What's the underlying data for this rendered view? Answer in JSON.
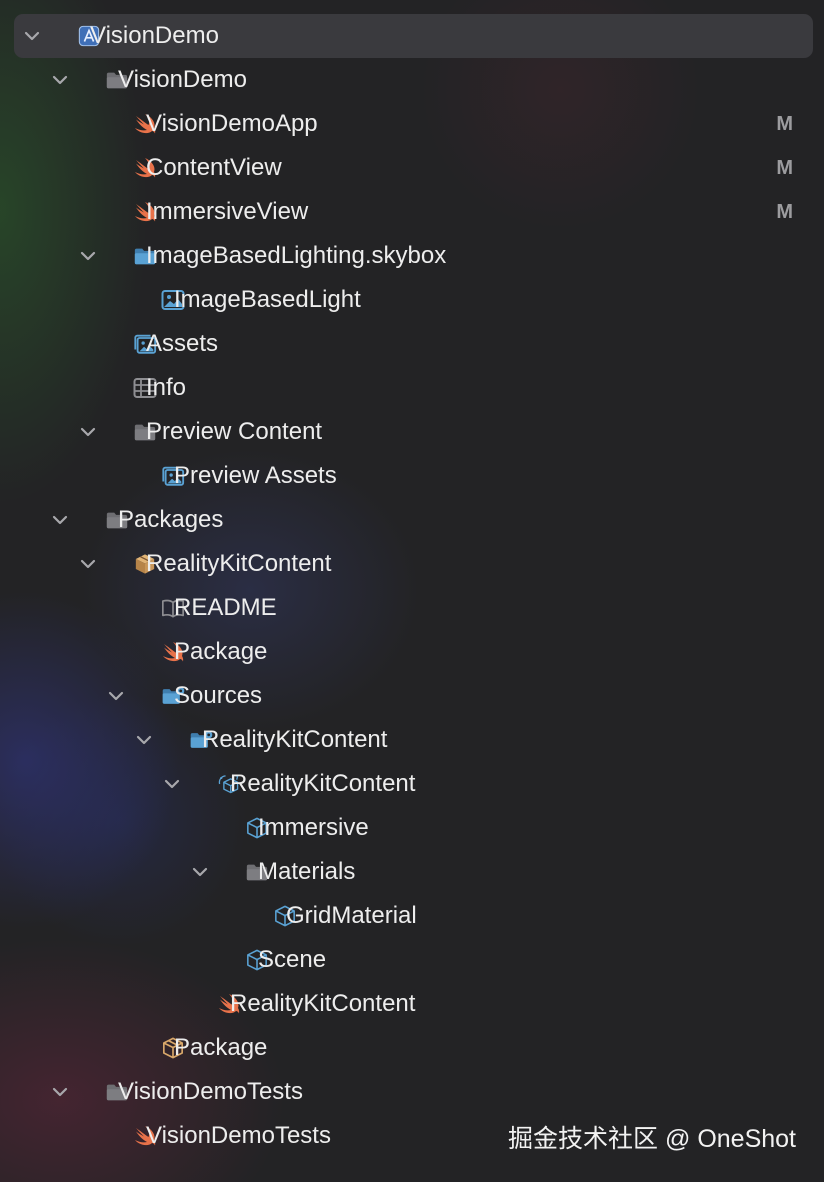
{
  "navigator": {
    "rows": [
      {
        "label": "VisionDemo",
        "level": 0,
        "icon": "xcode-project-icon",
        "expanded": true,
        "selected": true
      },
      {
        "label": "VisionDemo",
        "level": 1,
        "icon": "folder-icon",
        "expanded": true
      },
      {
        "label": "VisionDemoApp",
        "level": 2,
        "icon": "swift-file-icon",
        "badge": "M"
      },
      {
        "label": "ContentView",
        "level": 2,
        "icon": "swift-file-icon",
        "badge": "M"
      },
      {
        "label": "ImmersiveView",
        "level": 2,
        "icon": "swift-file-icon",
        "badge": "M"
      },
      {
        "label": "ImageBasedLighting.skybox",
        "level": 2,
        "icon": "skybox-folder-icon",
        "expanded": true
      },
      {
        "label": "ImageBasedLight",
        "level": 3,
        "icon": "image-icon"
      },
      {
        "label": "Assets",
        "level": 2,
        "icon": "asset-catalog-icon"
      },
      {
        "label": "Info",
        "level": 2,
        "icon": "plist-icon"
      },
      {
        "label": "Preview Content",
        "level": 2,
        "icon": "folder-icon",
        "expanded": true
      },
      {
        "label": "Preview Assets",
        "level": 3,
        "icon": "asset-catalog-icon"
      },
      {
        "label": "Packages",
        "level": 1,
        "icon": "folder-icon",
        "expanded": true
      },
      {
        "label": "RealityKitContent",
        "level": 2,
        "icon": "package-icon",
        "expanded": true
      },
      {
        "label": "README",
        "level": 3,
        "icon": "book-icon"
      },
      {
        "label": "Package",
        "level": 3,
        "icon": "swift-file-icon"
      },
      {
        "label": "Sources",
        "level": 3,
        "icon": "sources-folder-icon",
        "expanded": true
      },
      {
        "label": "RealityKitContent",
        "level": 4,
        "icon": "sources-folder-icon",
        "expanded": true
      },
      {
        "label": "RealityKitContent",
        "level": 5,
        "icon": "reality-bundle-icon",
        "expanded": true
      },
      {
        "label": "Immersive",
        "level": 6,
        "icon": "reality-scene-icon"
      },
      {
        "label": "Materials",
        "level": 6,
        "icon": "folder-icon",
        "expanded": true
      },
      {
        "label": "GridMaterial",
        "level": 7,
        "icon": "reality-scene-icon"
      },
      {
        "label": "Scene",
        "level": 6,
        "icon": "reality-scene-icon"
      },
      {
        "label": "RealityKitContent",
        "level": 5,
        "icon": "swift-file-icon"
      },
      {
        "label": "Package",
        "level": 3,
        "icon": "package-target-icon"
      },
      {
        "label": "VisionDemoTests",
        "level": 1,
        "icon": "folder-icon",
        "expanded": true
      },
      {
        "label": "VisionDemoTests",
        "level": 2,
        "icon": "swift-file-icon"
      }
    ]
  },
  "watermark": "掘金技术社区 @ OneShot",
  "colors": {
    "background": "#232325",
    "selected_row": "#3a3a3e",
    "folder_gray": "#6e6e72",
    "folder_blue": "#5aa2d4",
    "swift_orange": "#e8724a",
    "badge_gray": "#9c9c9f"
  }
}
